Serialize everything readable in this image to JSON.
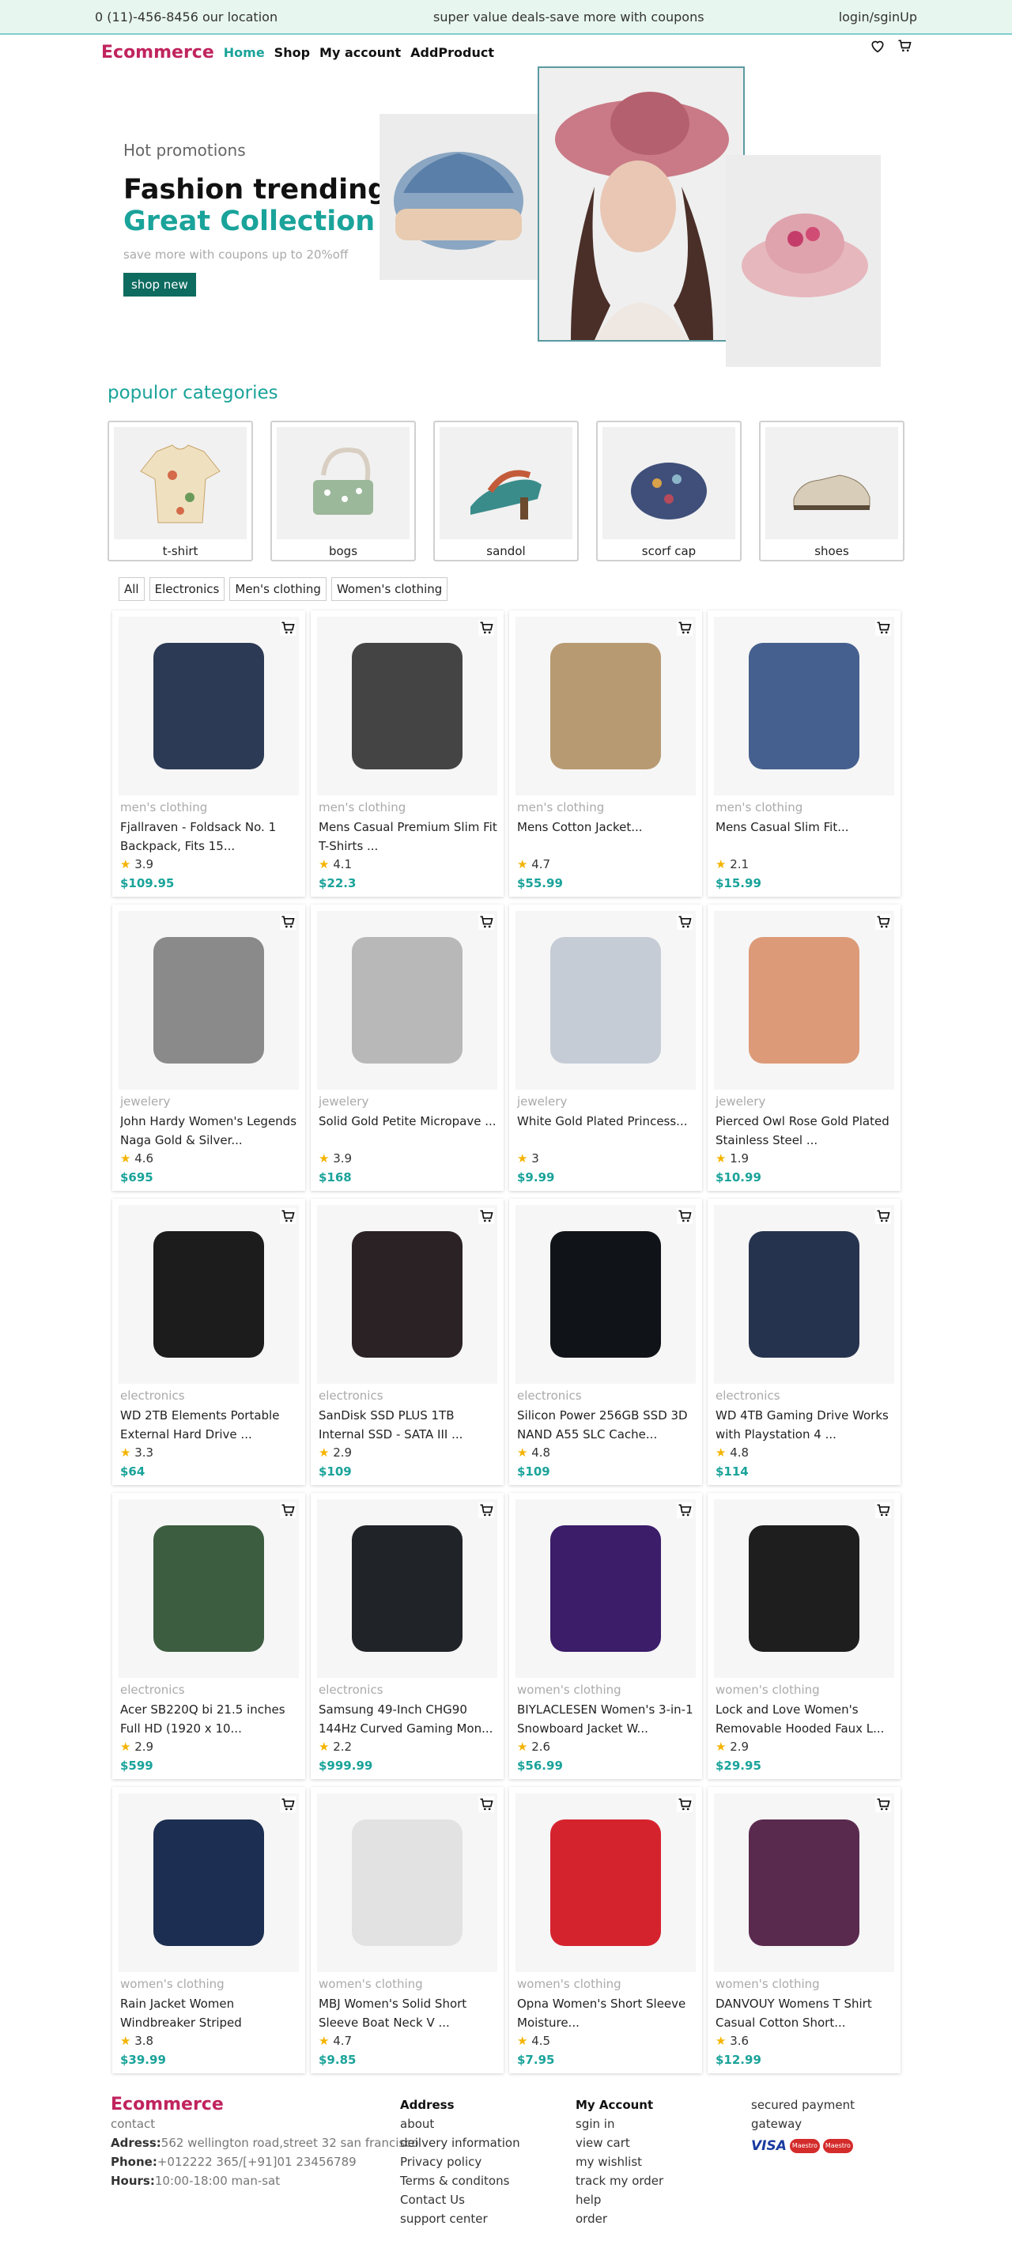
{
  "topbar": {
    "contact": "0 (11)-456-8456  our location",
    "promo": "super value deals-save more with coupons",
    "login": "login/sginUp"
  },
  "nav": {
    "logo": "Ecommerce",
    "links": [
      "Home",
      "Shop",
      "My account",
      "AddProduct"
    ]
  },
  "hero": {
    "sub": "Hot promotions",
    "title": "Fashion trending",
    "title2": "Great Collection",
    "desc": "save more with coupons up to 20%off",
    "button": "shop new"
  },
  "categories": {
    "title": "populor categories",
    "items": [
      "t-shirt",
      "bogs",
      "sandol",
      "scorf cap",
      "shoes"
    ]
  },
  "filters": [
    "All",
    "Electronics",
    "Men's clothing",
    "Women's clothing"
  ],
  "products": [
    {
      "category": "men's clothing",
      "title": "Fjallraven - Foldsack No. 1 Backpack, Fits 15...",
      "rating": "3.9",
      "price": "$109.95",
      "color": "#2c3a55"
    },
    {
      "category": "men's clothing",
      "title": "Mens Casual Premium Slim Fit T-Shirts ...",
      "rating": "4.1",
      "price": "$22.3",
      "color": "#444444"
    },
    {
      "category": "men's clothing",
      "title": "Mens Cotton Jacket...",
      "rating": "4.7",
      "price": "$55.99",
      "color": "#b89a72"
    },
    {
      "category": "men's clothing",
      "title": "Mens Casual Slim Fit...",
      "rating": "2.1",
      "price": "$15.99",
      "color": "#45608e"
    },
    {
      "category": "jewelery",
      "title": "John Hardy Women's Legends Naga Gold & Silver...",
      "rating": "4.6",
      "price": "$695",
      "color": "#8a8a8a"
    },
    {
      "category": "jewelery",
      "title": "Solid Gold Petite Micropave ...",
      "rating": "3.9",
      "price": "$168",
      "color": "#b8b8b8"
    },
    {
      "category": "jewelery",
      "title": "White Gold Plated Princess...",
      "rating": "3",
      "price": "$9.99",
      "color": "#c6ccd6"
    },
    {
      "category": "jewelery",
      "title": "Pierced Owl Rose Gold Plated Stainless Steel ...",
      "rating": "1.9",
      "price": "$10.99",
      "color": "#dd9a78"
    },
    {
      "category": "electronics",
      "title": "WD 2TB Elements Portable External Hard Drive ...",
      "rating": "3.3",
      "price": "$64",
      "color": "#1c1c1c"
    },
    {
      "category": "electronics",
      "title": "SanDisk SSD PLUS 1TB Internal SSD - SATA III ...",
      "rating": "2.9",
      "price": "$109",
      "color": "#2a2224"
    },
    {
      "category": "electronics",
      "title": "Silicon Power 256GB SSD 3D NAND A55 SLC Cache...",
      "rating": "4.8",
      "price": "$109",
      "color": "#101418"
    },
    {
      "category": "electronics",
      "title": "WD 4TB Gaming Drive Works with Playstation 4 ...",
      "rating": "4.8",
      "price": "$114",
      "color": "#26334f"
    },
    {
      "category": "electronics",
      "title": "Acer SB220Q bi 21.5 inches Full HD (1920 x 10...",
      "rating": "2.9",
      "price": "$599",
      "color": "#3d5d40"
    },
    {
      "category": "electronics",
      "title": "Samsung 49-Inch CHG90 144Hz Curved Gaming Mon...",
      "rating": "2.2",
      "price": "$999.99",
      "color": "#202428"
    },
    {
      "category": "women's clothing",
      "title": "BIYLACLESEN Women's 3-in-1 Snowboard Jacket W...",
      "rating": "2.6",
      "price": "$56.99",
      "color": "#3b1d6a"
    },
    {
      "category": "women's clothing",
      "title": "Lock and Love Women's Removable Hooded Faux L...",
      "rating": "2.9",
      "price": "$29.95",
      "color": "#1e1e1e"
    },
    {
      "category": "women's clothing",
      "title": "Rain Jacket Women Windbreaker Striped Climbin...",
      "rating": "3.8",
      "price": "$39.99",
      "color": "#1c2f52"
    },
    {
      "category": "women's clothing",
      "title": "MBJ Women's Solid Short Sleeve Boat Neck V ...",
      "rating": "4.7",
      "price": "$9.85",
      "color": "#e2e2e2"
    },
    {
      "category": "women's clothing",
      "title": "Opna Women's Short Sleeve Moisture...",
      "rating": "4.5",
      "price": "$7.95",
      "color": "#d5232e"
    },
    {
      "category": "women's clothing",
      "title": "DANVOUY Womens T Shirt Casual Cotton Short...",
      "rating": "3.6",
      "price": "$12.99",
      "color": "#5a2a4e"
    }
  ],
  "footer": {
    "logo": "Ecommerce",
    "contact": "contact",
    "address_label": "Adress:",
    "address": "562 wellington road,street 32 san francisco",
    "phone_label": "Phone:",
    "phone": "+012222 365/[+91]01 23456789",
    "hours_label": "Hours:",
    "hours": "10:00-18:00 man-sat",
    "col2_title": "Address",
    "col2": [
      "about",
      "deilvery information",
      "Privacy policy",
      "Terms & conditons",
      "Contact Us",
      "support center"
    ],
    "col3_title": "My Account",
    "col3": [
      "sgin in",
      "view cart",
      "my wishlist",
      "track my order",
      "help",
      "order"
    ],
    "payment_title": "secured payment gateway",
    "visa": "VISA",
    "maestro": "Maestro"
  }
}
